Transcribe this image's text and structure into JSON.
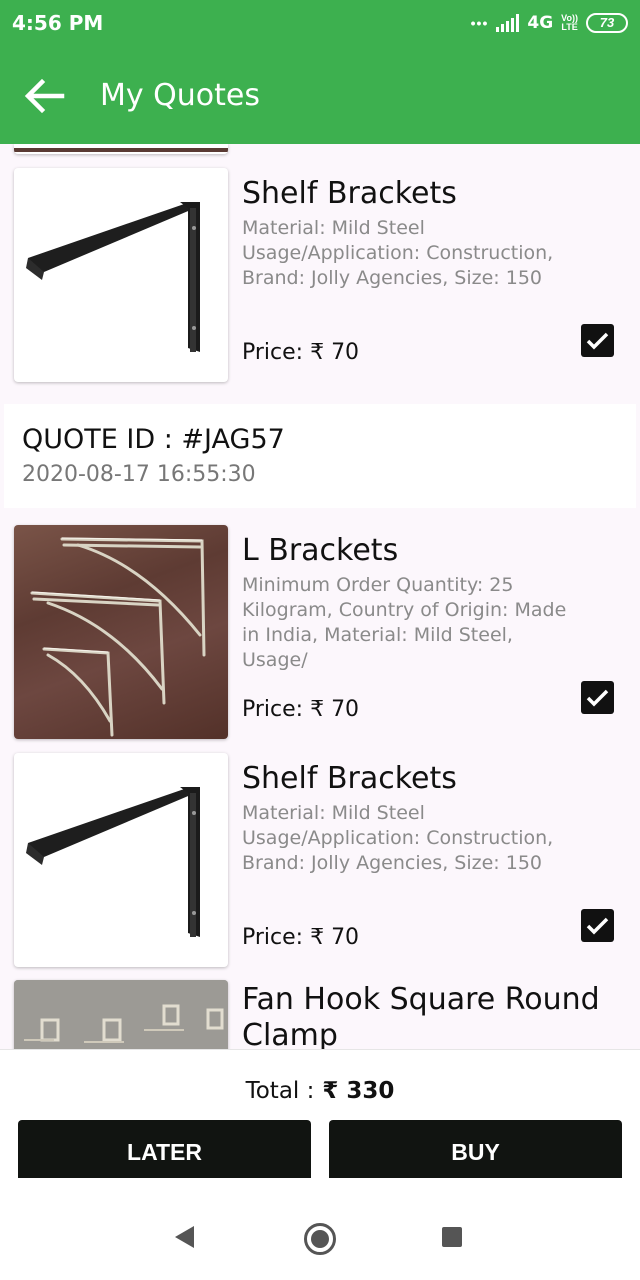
{
  "status_bar": {
    "time": "4:56 PM",
    "network": "4G",
    "volte_top": "Vo))",
    "volte_bottom": "LTE",
    "battery": "73"
  },
  "app_bar": {
    "title": "My Quotes",
    "back_icon": "arrow-left-icon"
  },
  "items_top": [
    {
      "name": "Shelf Brackets",
      "description": "Material: Mild Steel Usage/Application: Construction, Brand: Jolly Agencies, Size: 150",
      "price": "Price: ₹ 70",
      "checked": true
    }
  ],
  "quote": {
    "id": "QUOTE ID : #JAG57",
    "date": "2020-08-17 16:55:30"
  },
  "items": [
    {
      "name": "L Brackets",
      "description": "Minimum Order Quantity: 25 Kilogram, Country of Origin: Made in India, Material: Mild Steel, Usage/",
      "price": "Price: ₹ 70",
      "checked": true
    },
    {
      "name": "Shelf Brackets",
      "description": "Material: Mild Steel Usage/Application: Construction, Brand: Jolly Agencies, Size: 150",
      "price": "Price: ₹ 70",
      "checked": true
    },
    {
      "name": "Fan Hook Square Round Clamp"
    }
  ],
  "footer": {
    "total_label": "Total :",
    "total_value": "₹ 330",
    "later_label": "LATER",
    "buy_label": "BUY"
  },
  "colors": {
    "accent": "#3db04f",
    "button": "#111411"
  }
}
